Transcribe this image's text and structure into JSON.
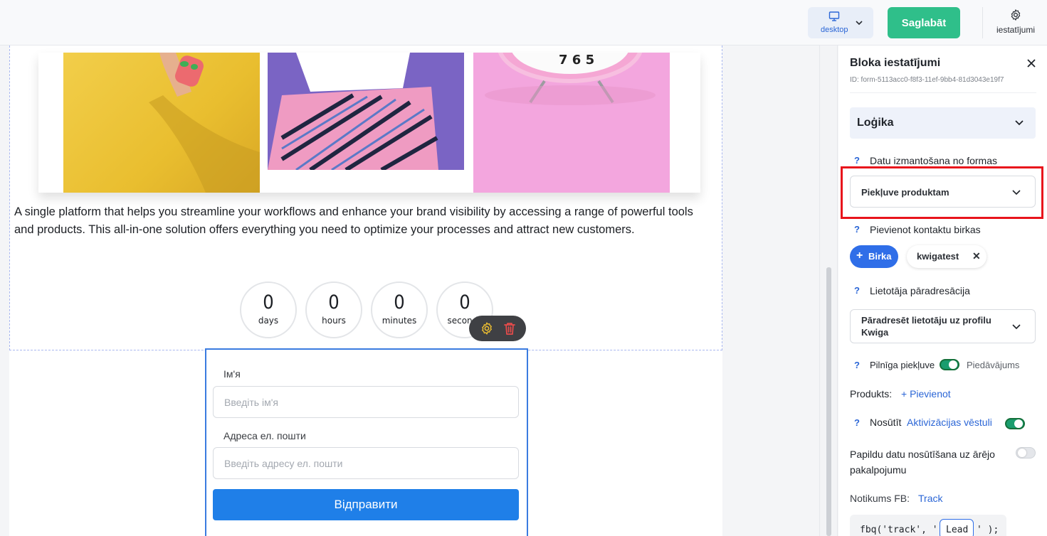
{
  "toolbar": {
    "device_label": "desktop",
    "save_label": "Saglabāt",
    "settings_label": "iestatījumi",
    "colors": {
      "save": "#2fbf8a",
      "accent": "#2b66d6"
    }
  },
  "canvas": {
    "paragraph": "A single platform that helps you streamline your workflows and enhance your brand visibility by accessing a range of powerful tools and products. This all-in-one solution offers everything you need to optimize your processes and attract new customers.",
    "countdown": [
      {
        "value": "0",
        "unit": "days"
      },
      {
        "value": "0",
        "unit": "hours"
      },
      {
        "value": "0",
        "unit": "minutes"
      },
      {
        "value": "0",
        "unit": "seconds"
      }
    ],
    "form": {
      "name_label": "Ім'я",
      "name_placeholder": "Введіть ім'я",
      "email_label": "Адреса ел. пошти",
      "email_placeholder": "Введіть адресу ел. пошти",
      "submit_label": "Відправити"
    }
  },
  "panel": {
    "title": "Bloka iestatījumi",
    "id_text": "ID: form-5113acc0-f8f3-11ef-9bb4-81d3043e19f7",
    "section_title": "Loģika",
    "q_mark": "?",
    "data_usage_label": "Datu izmantošana no formas",
    "data_usage_value": "Piekļuve produktam",
    "contact_tags_label": "Pievienot kontaktu birkas",
    "add_tag_label": "Birka",
    "tag_chip": "kwigatest",
    "redirect_label": "Lietotāja pāradresācija",
    "redirect_value": "Pāradresēt lietotāju uz profilu Kwiga",
    "full_access_label": "Pilnīga piekļuve",
    "offer_label": "Piedāvājums",
    "full_access_on": true,
    "product_label": "Produkts:",
    "add_product": "+ Pievienot",
    "send_label": "Nosūtīt",
    "activation_link": "Aktivizācijas vēstuli",
    "send_on": true,
    "extra_data_label": "Papildu datu nosūtīšana uz ārējo pakalpojumu",
    "extra_data_on": false,
    "fb_event_label": "Notikums FB:",
    "fb_event_value": "Track",
    "code_prefix": "fbq('track', '",
    "code_value": "Lead",
    "code_suffix": "' );"
  }
}
